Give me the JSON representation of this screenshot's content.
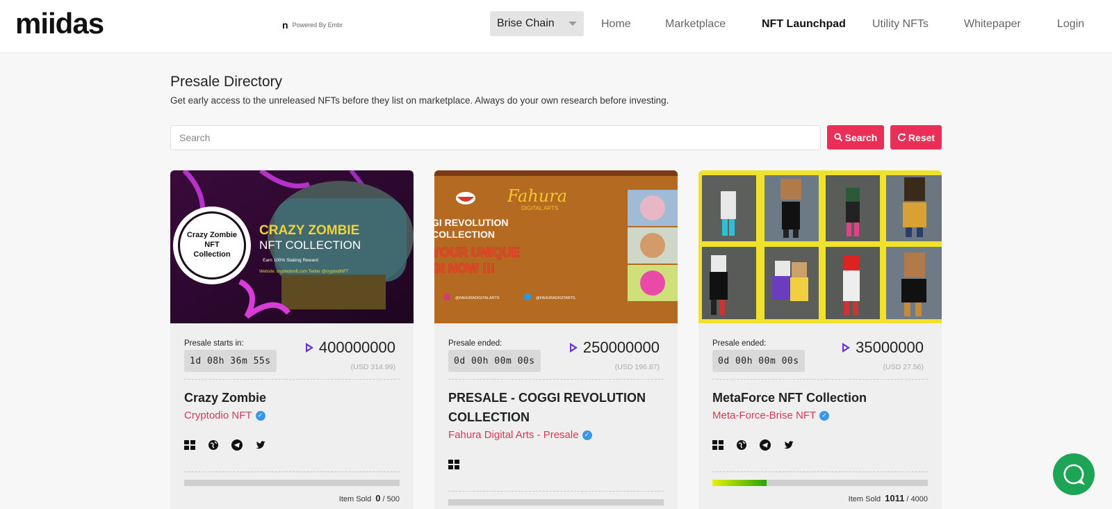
{
  "header": {
    "logo": "miidas",
    "powered_n": "n",
    "powered_text": "Powered By Embr",
    "chain_select": "Brise Chain",
    "nav": [
      "Home",
      "Marketplace",
      "NFT Launchpad",
      "Utility NFTs",
      "Whitepaper",
      "Login"
    ],
    "active_nav": "NFT Launchpad"
  },
  "page": {
    "title": "Presale Directory",
    "subtitle": "Get early access to the unreleased NFTs before they list on marketplace. Always do your own research before investing.",
    "search_placeholder": "Search",
    "search_button": "Search",
    "reset_button": "Reset"
  },
  "cards": [
    {
      "banner": {
        "badge_lines": [
          "Crazy Zombie",
          "NFT",
          "Collection"
        ],
        "headline": "CRAZY ZOMBIE",
        "subhead": "NFT COLLECTION",
        "line1": "Earn 100% Staking Reward",
        "line2": "Website: cryptodionft.com  Twitter @cryptodiNFT"
      },
      "status_label": "Presale starts in:",
      "timer": "1d 08h 36m 55s",
      "price": "400000000",
      "usd": "(USD 314.99)",
      "name": "Crazy Zombie",
      "creator": "Cryptodio NFT",
      "socials": [
        "grid-icon",
        "globe-icon",
        "telegram-icon",
        "twitter-icon"
      ],
      "sold_label": "Item Sold",
      "sold_count": "0",
      "sold_total": "/ 500",
      "progress": 0
    },
    {
      "banner": {
        "brand": "Fahura",
        "brand_sub": "DIGITAL ARTS",
        "line1": "GI REVOLUTION",
        "line2": "COLLECTION",
        "line3": "YOUR UNIQUE",
        "line4": "GI NOW !!!",
        "handle1": "@FAHURADIGITALARTS",
        "handle2": "@FAHURADIGITARTS"
      },
      "status_label": "Presale ended:",
      "timer": "0d 00h 00m 00s",
      "price": "250000000",
      "usd": "(USD 196.87)",
      "name": "PRESALE - COGGI REVOLUTION COLLECTION",
      "creator": "Fahura Digital Arts - Presale",
      "socials": [
        "grid-icon"
      ],
      "progress": 0
    },
    {
      "status_label": "Presale ended:",
      "timer": "0d 00h 00m 00s",
      "price": "35000000",
      "usd": "(USD 27.56)",
      "name": "MetaForce NFT Collection",
      "creator": "Meta-Force-Brise NFT",
      "socials": [
        "grid-icon",
        "globe-icon",
        "telegram-icon",
        "twitter-icon"
      ],
      "sold_label": "Item Sold",
      "sold_count": "1011",
      "sold_total": "/ 4000",
      "progress": 0.2528
    }
  ],
  "colors": {
    "accent": "#e92e57",
    "creator": "#d73756",
    "verified": "#3b97e8",
    "chat": "#1ea455"
  }
}
